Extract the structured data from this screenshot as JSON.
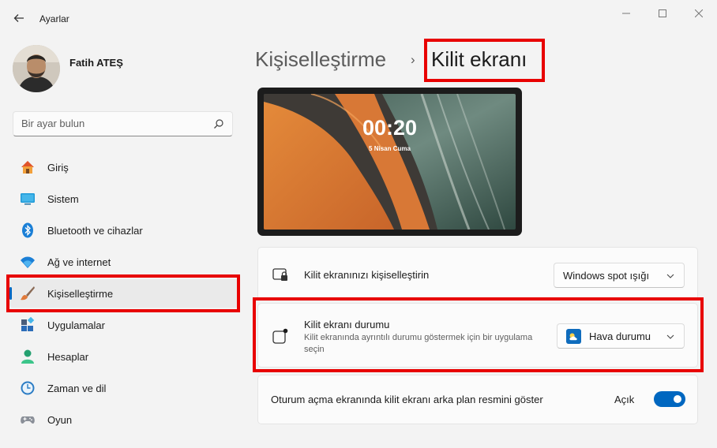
{
  "app": {
    "title": "Ayarlar",
    "back_icon": "back-arrow-icon"
  },
  "user": {
    "name": "Fatih ATEŞ"
  },
  "search": {
    "placeholder": "Bir ayar bulun",
    "value": ""
  },
  "sidebar": {
    "items": [
      {
        "label": "Giriş",
        "icon": "home-icon"
      },
      {
        "label": "Sistem",
        "icon": "monitor-icon"
      },
      {
        "label": "Bluetooth ve cihazlar",
        "icon": "bluetooth-icon"
      },
      {
        "label": "Ağ ve internet",
        "icon": "wifi-icon"
      },
      {
        "label": "Kişiselleştirme",
        "icon": "brush-icon",
        "active": true
      },
      {
        "label": "Uygulamalar",
        "icon": "apps-icon"
      },
      {
        "label": "Hesaplar",
        "icon": "person-icon"
      },
      {
        "label": "Zaman ve dil",
        "icon": "clock-globe-icon"
      },
      {
        "label": "Oyun",
        "icon": "gamepad-icon"
      }
    ]
  },
  "breadcrumb": {
    "parent": "Kişiselleştirme",
    "separator": "›",
    "current": "Kilit ekranı"
  },
  "preview": {
    "time": "00:20",
    "date": "5 Nisan Cuma"
  },
  "settings": {
    "personalize": {
      "title": "Kilit ekranınızı kişiselleştirin",
      "value": "Windows spot ışığı",
      "icon": "lock-screen-icon"
    },
    "status": {
      "title": "Kilit ekranı durumu",
      "subtitle": "Kilit ekranında ayrıntılı durumu göstermek için bir uygulama seçin",
      "value": "Hava durumu",
      "icon": "status-notification-icon",
      "value_icon": "weather-app-icon"
    },
    "signin_background": {
      "title": "Oturum açma ekranında kilit ekranı arka plan resmini göster",
      "toggle_label": "Açık",
      "on": true
    }
  },
  "colors": {
    "accent": "#0067c0",
    "highlight": "#e80000"
  }
}
